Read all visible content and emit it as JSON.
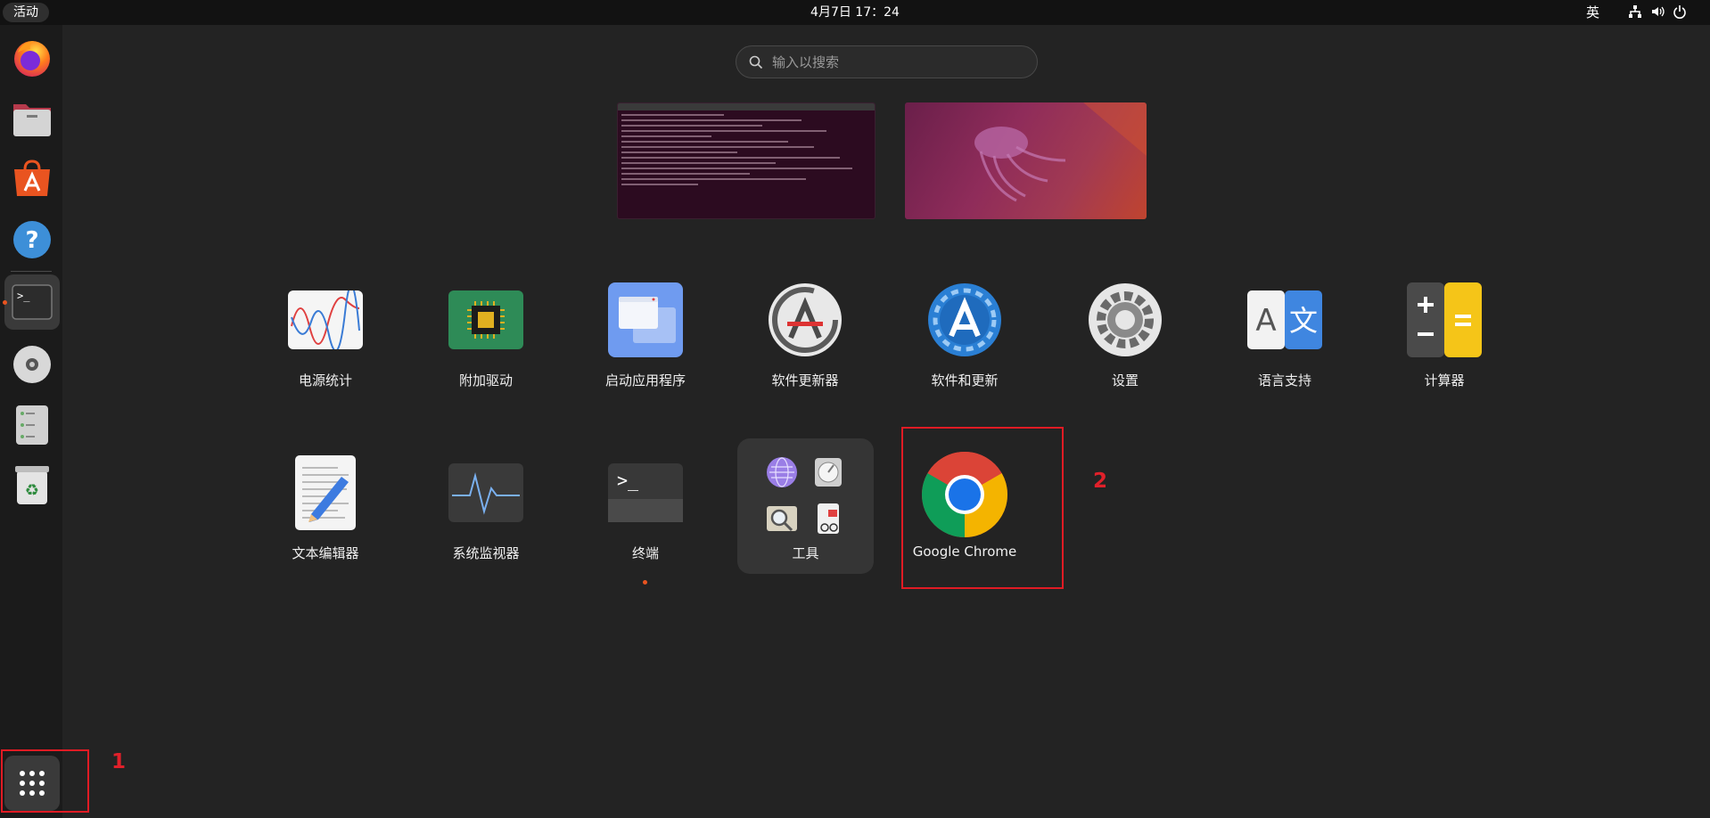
{
  "topbar": {
    "activities_label": "活动",
    "clock": "4月7日 17：24",
    "input_method": "英"
  },
  "search": {
    "placeholder": "输入以搜索"
  },
  "dock": {
    "items": [
      "firefox-icon",
      "files-icon",
      "app-center-icon",
      "help-icon",
      "terminal-icon",
      "disc-icon",
      "disks-icon",
      "trash-icon",
      "show-apps-icon"
    ]
  },
  "apps": {
    "row1": [
      {
        "label": "电源统计"
      },
      {
        "label": "附加驱动"
      },
      {
        "label": "启动应用程序"
      },
      {
        "label": "软件更新器"
      },
      {
        "label": "软件和更新"
      },
      {
        "label": "设置"
      },
      {
        "label": "语言支持"
      },
      {
        "label": "计算器"
      }
    ],
    "row2": [
      {
        "label": "文本编辑器"
      },
      {
        "label": "系统监视器"
      },
      {
        "label": "终端"
      },
      {
        "label": "工具"
      },
      {
        "label": "Google Chrome"
      }
    ]
  },
  "annotations": [
    {
      "number": "1"
    },
    {
      "number": "2"
    }
  ],
  "colors": {
    "accent": "#e95420",
    "annotation": "#e01b24",
    "chrome_blue": "#1a73e8"
  }
}
